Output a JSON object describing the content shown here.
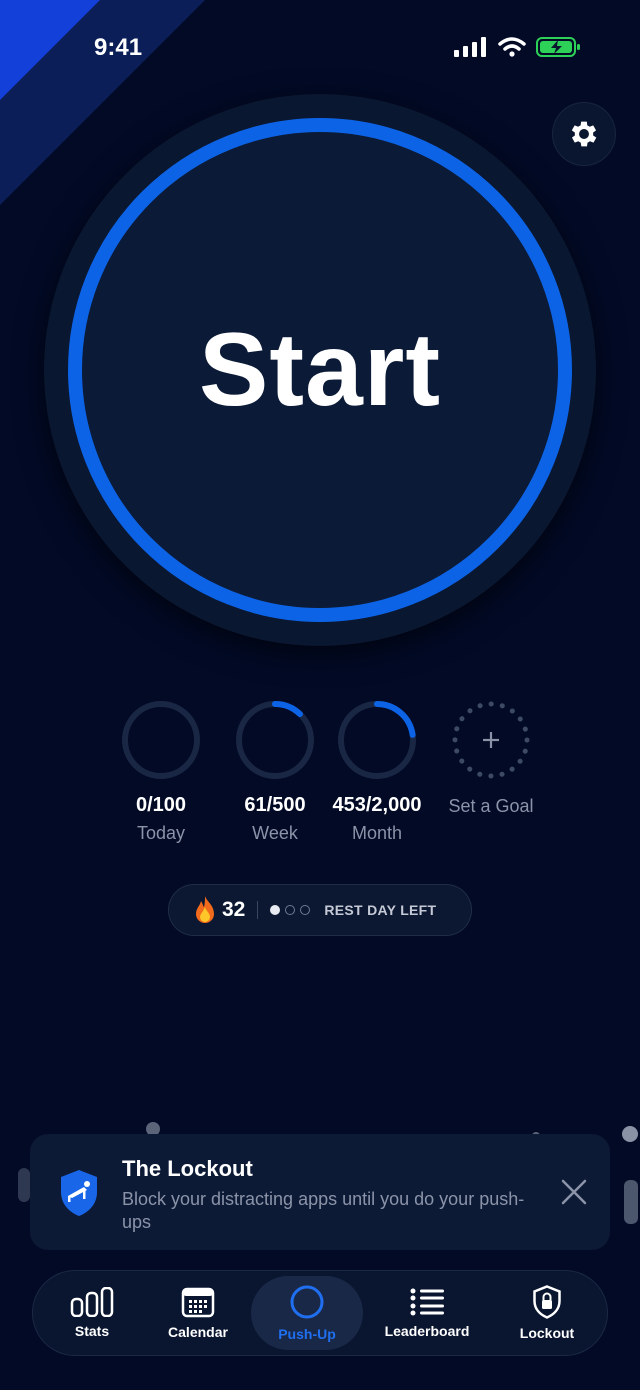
{
  "status": {
    "time": "9:41"
  },
  "start_button": {
    "label": "Start"
  },
  "goals": [
    {
      "value": "0/100",
      "label": "Today",
      "progress": 0
    },
    {
      "value": "61/500",
      "label": "Week",
      "progress": 0.122
    },
    {
      "value": "453/2,000",
      "label": "Month",
      "progress": 0.2265
    }
  ],
  "set_goal": {
    "label": "Set a Goal"
  },
  "streak": {
    "count": "32",
    "rest_days_used": 1,
    "rest_days_total": 3,
    "rest_label": "REST DAY LEFT"
  },
  "lockout_card": {
    "title": "The Lockout",
    "description": "Block your distracting apps until you do your push-ups"
  },
  "tabs": [
    {
      "label": "Stats",
      "icon": "stats-icon"
    },
    {
      "label": "Calendar",
      "icon": "calendar-icon"
    },
    {
      "label": "Push-Up",
      "icon": "pushup-circle-icon",
      "active": true
    },
    {
      "label": "Leaderboard",
      "icon": "leaderboard-icon"
    },
    {
      "label": "Lockout",
      "icon": "lock-shield-icon"
    }
  ],
  "colors": {
    "accent": "#0d63e6",
    "background": "#020a26",
    "card": "#0c1a36",
    "muted": "#8b93a8"
  }
}
